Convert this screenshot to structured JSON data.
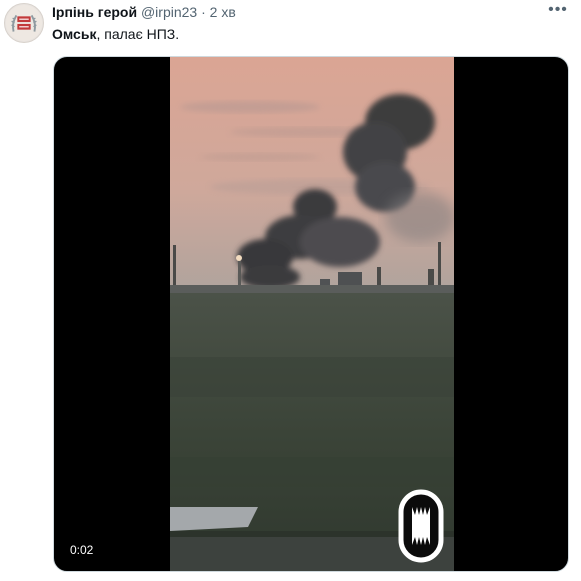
{
  "tweet": {
    "author_name": "Ірпінь герой",
    "handle": "@irpin23",
    "separator": "·",
    "time": "2 хв",
    "more_glyph": "•••",
    "text_bold": "Омськ",
    "text_rest": ", палає НПЗ."
  },
  "media": {
    "timestamp": "0:02"
  },
  "icons": {
    "avatar": "avatar-logo-icon",
    "more": "more-options-icon",
    "watermark": "channel-watermark-icon"
  },
  "colors": {
    "name": "#0f1419",
    "secondary": "#536471",
    "media_bg": "#000000",
    "sky_top": "#d9a494",
    "sky_bottom": "#b5a29a",
    "field": "#3f4a3c"
  }
}
